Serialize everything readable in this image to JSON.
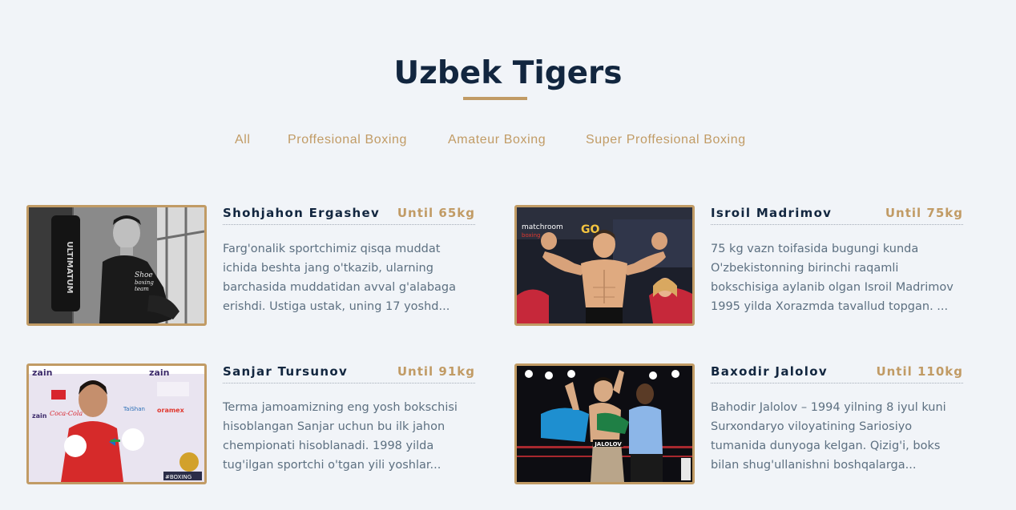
{
  "section": {
    "title": "Uzbek Tigers"
  },
  "filters": [
    {
      "label": "All"
    },
    {
      "label": "Proffesional Boxing"
    },
    {
      "label": "Amateur Boxing"
    },
    {
      "label": "Super Proffesional Boxing"
    }
  ],
  "boxers": [
    {
      "name": "Shohjahon Ergashev",
      "weight": "Until 65kg",
      "description": "Farg'onalik sportchimiz qisqa muddat ichida beshta jang o'tkazib, ularning barchasida muddatidan avval g'alabaga erishdi. Ustiga ustak, uning 17 yoshd..."
    },
    {
      "name": "Isroil Madrimov",
      "weight": "Until 75kg",
      "description": "75 kg vazn toifasida bugungi kunda O'zbekistonning birinchi raqamli bokschisiga aylanib olgan Isroil Madrimov 1995 yilda Xorazmda tavallud topgan. ..."
    },
    {
      "name": "Sanjar Tursunov",
      "weight": "Until 91kg",
      "description": "Terma jamoamizning eng yosh bokschisi hisoblangan Sanjar uchun bu ilk jahon chempionati hisoblanadi. 1998 yilda tug'ilgan sportchi o'tgan yili yoshlar..."
    },
    {
      "name": "Baxodir Jalolov",
      "weight": "Until 110kg",
      "description": "Bahodir Jalolov – 1994 yilning 8 iyul kuni Surxondaryo viloyatining Sariosiyo tumanida dunyoga kelgan. Qizig'i, boks bilan shug'ullanishni boshqalarga..."
    }
  ],
  "photo_texts": {
    "ergashev": {
      "shirt": [
        "Shoe",
        "boxing",
        "team"
      ],
      "bag": "ULTIMATUM"
    },
    "madrimov": {
      "banner": "matchroom",
      "sub": "boxing",
      "corner": "GO"
    },
    "tursunov": {
      "sponsor": "zain",
      "sponsor2": "oramex",
      "sponsor3": "TaiShan",
      "sponsor4": "Coca-Cola",
      "tag": "#BOXING"
    },
    "jalolov": {
      "trunks": "JALOLOV"
    }
  },
  "colors": {
    "accent": "#c19b65",
    "heading": "#12263f",
    "body_text": "#5d7081",
    "background": "#f1f4f8"
  }
}
